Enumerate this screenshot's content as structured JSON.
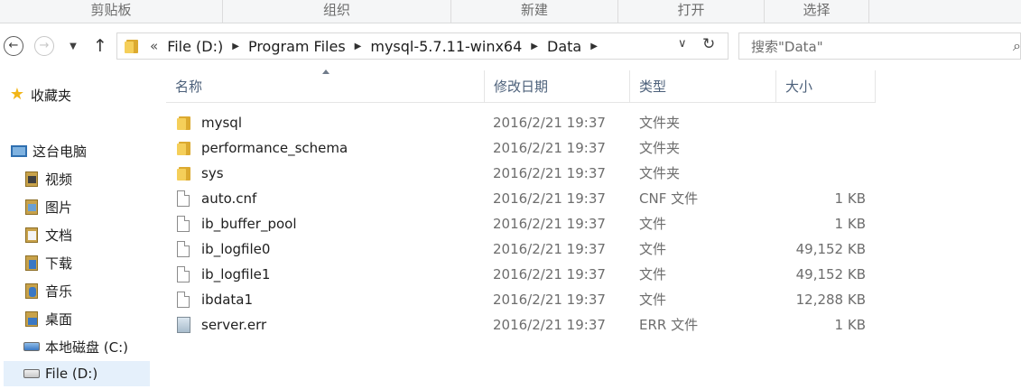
{
  "ribbon": {
    "groups": [
      "剪贴板",
      "组织",
      "新建",
      "打开",
      "选择"
    ]
  },
  "nav": {
    "back_icon": "back-arrow-icon",
    "forward_icon": "forward-arrow-icon",
    "recent_icon": "chevron-down-icon",
    "up_icon": "up-arrow-icon",
    "overflow": "«",
    "breadcrumbs": [
      "File (D:)",
      "Program Files",
      "mysql-5.7.11-winx64",
      "Data"
    ],
    "dropdown_glyph": "∨",
    "refresh_glyph": "↻",
    "search_placeholder": "搜索\"Data\"",
    "search_icon": "search-icon"
  },
  "sidebar": {
    "favorites": "收藏夹",
    "this_pc": "这台电脑",
    "items": [
      {
        "label": "视频",
        "icon": "video-library-icon"
      },
      {
        "label": "图片",
        "icon": "pictures-library-icon"
      },
      {
        "label": "文档",
        "icon": "documents-library-icon"
      },
      {
        "label": "下载",
        "icon": "downloads-library-icon"
      },
      {
        "label": "音乐",
        "icon": "music-library-icon"
      },
      {
        "label": "桌面",
        "icon": "desktop-icon"
      },
      {
        "label": "本地磁盘 (C:)",
        "icon": "system-drive-icon"
      },
      {
        "label": "File (D:)",
        "icon": "drive-icon"
      }
    ]
  },
  "columns": {
    "name": "名称",
    "date": "修改日期",
    "type": "类型",
    "size": "大小"
  },
  "files": [
    {
      "name": "mysql",
      "date": "2016/2/21 19:37",
      "type": "文件夹",
      "size": "",
      "kind": "folder"
    },
    {
      "name": "performance_schema",
      "date": "2016/2/21 19:37",
      "type": "文件夹",
      "size": "",
      "kind": "folder"
    },
    {
      "name": "sys",
      "date": "2016/2/21 19:37",
      "type": "文件夹",
      "size": "",
      "kind": "folder"
    },
    {
      "name": "auto.cnf",
      "date": "2016/2/21 19:37",
      "type": "CNF 文件",
      "size": "1 KB",
      "kind": "file"
    },
    {
      "name": "ib_buffer_pool",
      "date": "2016/2/21 19:37",
      "type": "文件",
      "size": "1 KB",
      "kind": "file"
    },
    {
      "name": "ib_logfile0",
      "date": "2016/2/21 19:37",
      "type": "文件",
      "size": "49,152 KB",
      "kind": "file"
    },
    {
      "name": "ib_logfile1",
      "date": "2016/2/21 19:37",
      "type": "文件",
      "size": "49,152 KB",
      "kind": "file"
    },
    {
      "name": "ibdata1",
      "date": "2016/2/21 19:37",
      "type": "文件",
      "size": "12,288 KB",
      "kind": "file"
    },
    {
      "name": "server.err",
      "date": "2016/2/21 19:37",
      "type": "ERR 文件",
      "size": "1 KB",
      "kind": "err"
    }
  ]
}
